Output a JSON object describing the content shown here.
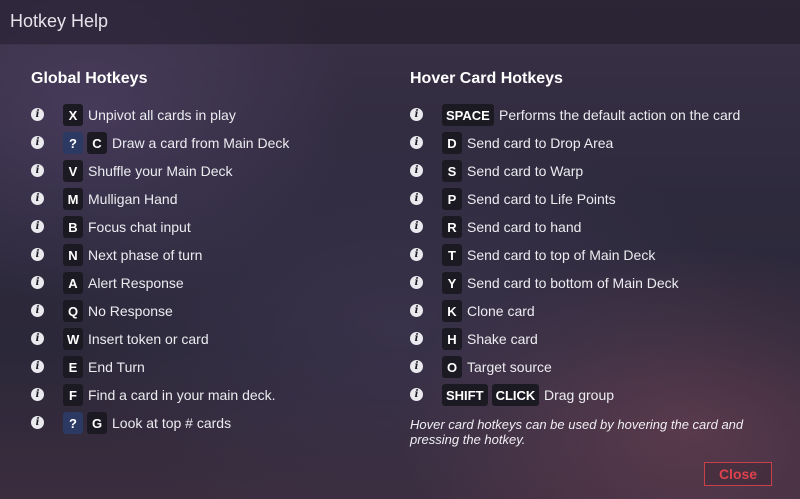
{
  "window": {
    "title": "Hotkey Help"
  },
  "global": {
    "title": "Global Hotkeys",
    "items": [
      {
        "keys": [
          "X"
        ],
        "desc": "Unpivot all cards in play"
      },
      {
        "keys": [
          "?",
          "C"
        ],
        "desc": "Draw a card from Main Deck"
      },
      {
        "keys": [
          "V"
        ],
        "desc": "Shuffle your Main Deck"
      },
      {
        "keys": [
          "M"
        ],
        "desc": "Mulligan Hand"
      },
      {
        "keys": [
          "B"
        ],
        "desc": "Focus chat input"
      },
      {
        "keys": [
          "N"
        ],
        "desc": "Next phase of turn"
      },
      {
        "keys": [
          "A"
        ],
        "desc": "Alert Response"
      },
      {
        "keys": [
          "Q"
        ],
        "desc": "No Response"
      },
      {
        "keys": [
          "W"
        ],
        "desc": "Insert token or card"
      },
      {
        "keys": [
          "E"
        ],
        "desc": "End Turn"
      },
      {
        "keys": [
          "F"
        ],
        "desc": "Find a card in your main deck."
      },
      {
        "keys": [
          "?",
          "G"
        ],
        "desc": "Look at top # cards"
      }
    ]
  },
  "hover": {
    "title": "Hover Card Hotkeys",
    "items": [
      {
        "keys": [
          "SPACE"
        ],
        "desc": "Performs the default action on the card"
      },
      {
        "keys": [
          "D"
        ],
        "desc": "Send card to Drop Area"
      },
      {
        "keys": [
          "S"
        ],
        "desc": "Send card to Warp"
      },
      {
        "keys": [
          "P"
        ],
        "desc": "Send card to Life Points"
      },
      {
        "keys": [
          "R"
        ],
        "desc": "Send card to hand"
      },
      {
        "keys": [
          "T"
        ],
        "desc": "Send card to top of Main Deck"
      },
      {
        "keys": [
          "Y"
        ],
        "desc": "Send card to bottom of Main Deck"
      },
      {
        "keys": [
          "K"
        ],
        "desc": "Clone card"
      },
      {
        "keys": [
          "H"
        ],
        "desc": "Shake card"
      },
      {
        "keys": [
          "O"
        ],
        "desc": "Target source"
      },
      {
        "keys": [
          "SHIFT",
          "CLICK"
        ],
        "desc": "Drag group"
      }
    ],
    "note": "Hover card hotkeys can be used by hovering the card and pressing the hotkey."
  },
  "info_icon": "info-icon",
  "close_label": "Close",
  "colors": {
    "accent_close": "#e0424c",
    "key_bg": "#1b1a22",
    "help_key_bg": "#2c3a63"
  }
}
